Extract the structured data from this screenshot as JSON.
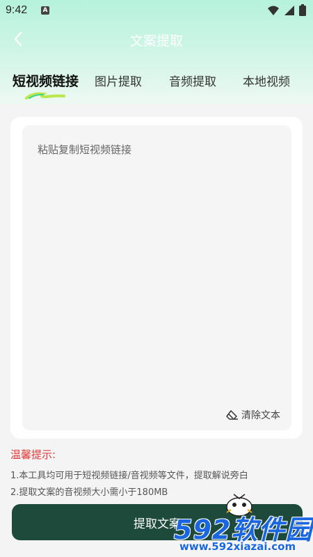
{
  "status": {
    "time": "9:42",
    "notification_badge": "A",
    "icons": [
      "wifi-icon",
      "signal-icon",
      "battery-icon"
    ]
  },
  "nav": {
    "title": "文案提取",
    "back_icon": "chevron-left-icon"
  },
  "tabs": [
    {
      "label": "短视频链接",
      "active": true
    },
    {
      "label": "图片提取",
      "active": false
    },
    {
      "label": "音频提取",
      "active": false
    },
    {
      "label": "本地视频",
      "active": false
    }
  ],
  "input": {
    "placeholder": "粘贴复制短视频链接",
    "value": ""
  },
  "clear": {
    "label": "清除文本",
    "icon": "eraser-icon"
  },
  "tips": {
    "title": "温馨提示:",
    "lines": [
      "1.本工具均可用于短视频链接/音视频等文件，提取解说旁白",
      "2.提取文案的音视频大小需小于180MB"
    ]
  },
  "action": {
    "label": "提取文案"
  },
  "watermark": {
    "main": "592软件园",
    "url": "www.592xiazai.com"
  },
  "colors": {
    "accent": "#1d4a3b",
    "header": "#b6f2dc",
    "warning": "#e23a3a",
    "watermark": "#1a66e0"
  }
}
